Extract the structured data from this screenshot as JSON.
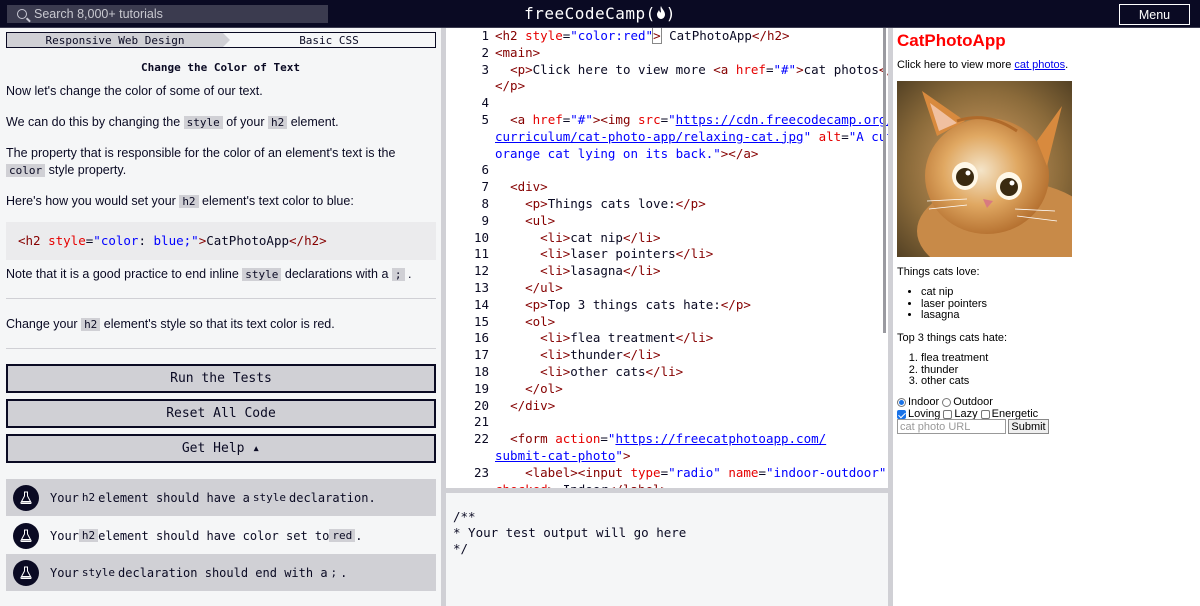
{
  "nav": {
    "search_placeholder": "Search 8,000+ tutorials",
    "logo_text": "freeCodeCamp(",
    "logo_close": ")",
    "menu_label": "Menu"
  },
  "breadcrumb": {
    "superblock": "Responsive Web Design",
    "block": "Basic CSS"
  },
  "challenge": {
    "title": "Change the Color of Text",
    "p1": "Now let's change the color of some of our text.",
    "p2_a": "We can do this by changing the ",
    "p2_code1": "style",
    "p2_b": " of your ",
    "p2_code2": "h2",
    "p2_c": " element.",
    "p3_a": "The property that is responsible for the color of an element's text is the ",
    "p3_code": "color",
    "p3_b": " style property.",
    "p4_a": "Here's how you would set your ",
    "p4_code": "h2",
    "p4_b": " element's text color to blue:",
    "example_tag_open": "<h2 ",
    "example_attr": "style",
    "example_eq": "=",
    "example_q1": "\"",
    "example_prop": "color",
    "example_colon": ": ",
    "example_val": "blue",
    "example_end": ";\"",
    "example_gt": ">",
    "example_text": "CatPhotoApp",
    "example_close": "</h2>",
    "note_a": "Note that it is a good practice to end inline ",
    "note_code1": "style",
    "note_b": " declarations with a ",
    "note_code2": ";",
    "note_c": " .",
    "instr_a": "Change your ",
    "instr_code": "h2",
    "instr_b": " element's style so that its text color is red."
  },
  "buttons": {
    "run": "Run the Tests",
    "reset": "Reset All Code",
    "help": "Get Help ▴"
  },
  "tests": [
    {
      "a": "Your ",
      "code1": "h2",
      "b": " element should have a ",
      "code2": "style",
      "c": " declaration."
    },
    {
      "a": "Your ",
      "code1": "h2",
      "b": " element should have color set to ",
      "code2": "red",
      "c": "."
    },
    {
      "a": "Your ",
      "code1": "style",
      "b": " declaration should end with a ",
      "code2": ";",
      "c": " ."
    }
  ],
  "editor": {
    "line_numbers": [
      "1",
      "2",
      "3",
      "",
      "4",
      "5",
      "",
      "",
      "6",
      "7",
      "8",
      "9",
      "10",
      "11",
      "12",
      "13",
      "14",
      "15",
      "16",
      "17",
      "18",
      "19",
      "20",
      "21",
      "22",
      "",
      "23"
    ]
  },
  "console": {
    "l1": "/**",
    "l2": "* Your test output will go here",
    "l3": "*/"
  },
  "preview": {
    "title": "CatPhotoApp",
    "intro": "Click here to view more ",
    "intro_link": "cat photos",
    "intro_end": ".",
    "love_heading": "Things cats love:",
    "love": [
      "cat nip",
      "laser pointers",
      "lasagna"
    ],
    "hate_heading": "Top 3 things cats hate:",
    "hate": [
      "flea treatment",
      "thunder",
      "other cats"
    ],
    "radio_indoor": "Indoor",
    "radio_outdoor": "Outdoor",
    "check_loving": "Loving",
    "check_lazy": "Lazy",
    "check_energetic": "Energetic",
    "url_placeholder": "cat photo URL",
    "submit": "Submit"
  },
  "colors": {
    "nav_bg": "#0a0a23",
    "panel_bg": "#f5f6f7",
    "code_tag": "#850000",
    "code_attr": "#e50000",
    "code_string": "#0000ff",
    "preview_title": "#ff0000"
  }
}
